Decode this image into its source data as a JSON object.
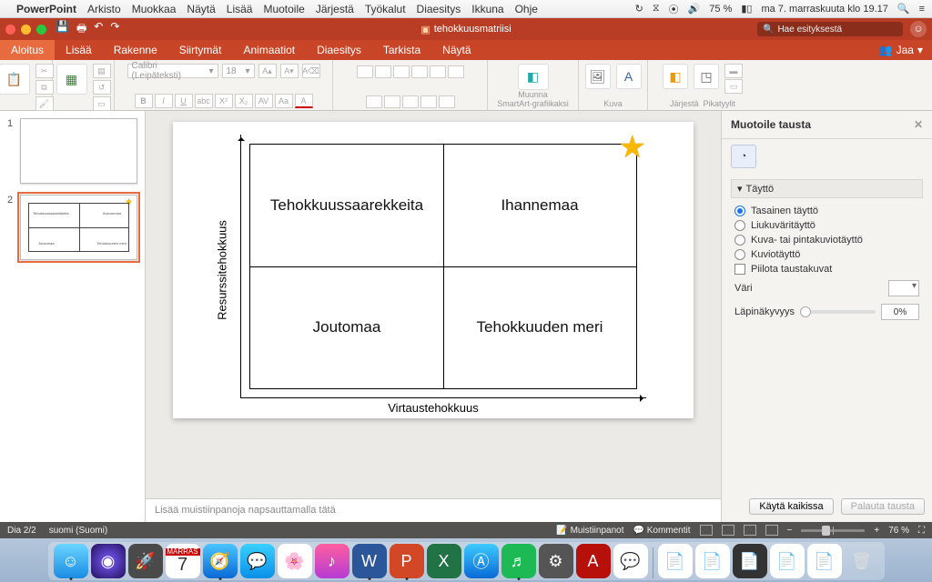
{
  "menubar": {
    "app": "PowerPoint",
    "items": [
      "Arkisto",
      "Muokkaa",
      "Näytä",
      "Lisää",
      "Muotoile",
      "Järjestä",
      "Työkalut",
      "Diaesitys",
      "Ikkuna",
      "Ohje"
    ],
    "battery": "75 %",
    "datetime": "ma 7. marraskuuta klo  19.17"
  },
  "window": {
    "title": "tehokkuusmatriisi",
    "search_placeholder": "Hae esityksestä"
  },
  "tabs": {
    "items": [
      "Aloitus",
      "Lisää",
      "Rakenne",
      "Siirtymät",
      "Animaatiot",
      "Diaesitys",
      "Tarkista",
      "Näytä"
    ],
    "active": "Aloitus",
    "share": "Jaa"
  },
  "ribbon": {
    "paste": "Sijoita",
    "newslide": "Uusi dia",
    "font_name": "Calibri (Leipäteksti)",
    "font_size": "18",
    "smartart_a": "Muunna",
    "smartart_b": "SmartArt-grafiikaksi",
    "picture": "Kuva",
    "arrange": "Järjestä",
    "quickstyles": "Pikatyylit"
  },
  "thumbs": {
    "n1": "1",
    "n2": "2"
  },
  "slide": {
    "q1": "Tehokkuussaarekkeita",
    "q2": "Ihannemaa",
    "q3": "Joutomaa",
    "q4": "Tehokkuuden meri",
    "ylabel": "Resurssitehokkuus",
    "xlabel": "Virtaustehokkuus"
  },
  "notes": {
    "placeholder": "Lisää muistiinpanoja napsauttamalla tätä"
  },
  "format_panel": {
    "title": "Muotoile tausta",
    "section": "Täyttö",
    "r1": "Tasainen täyttö",
    "r2": "Liukuväritäyttö",
    "r3": "Kuva- tai pintakuviotäyttö",
    "r4": "Kuviotäyttö",
    "hide": "Piilota taustakuvat",
    "color": "Väri",
    "opacity": "Läpinäkyvyys",
    "opacity_val": "0%",
    "apply_all": "Käytä kaikissa",
    "reset": "Palauta tausta"
  },
  "status": {
    "slide": "Dia 2/2",
    "lang": "suomi (Suomi)",
    "notes": "Muistiinpanot",
    "comments": "Kommentit",
    "zoom": "76 %"
  },
  "chart_data": {
    "type": "table",
    "xlabel": "Virtaustehokkuus",
    "ylabel": "Resurssitehokkuus",
    "quadrants": {
      "top_left": "Tehokkuussaarekkeita",
      "top_right": "Ihannemaa",
      "bottom_left": "Joutomaa",
      "bottom_right": "Tehokkuuden meri"
    },
    "star_position": "top_right"
  }
}
